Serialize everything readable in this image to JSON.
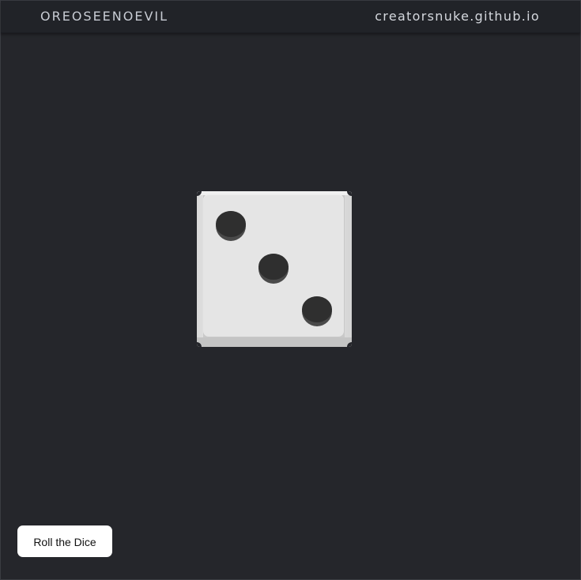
{
  "header": {
    "brand": "OREOSEENOEVIL",
    "site": "creatorsnuke.github.io"
  },
  "die": {
    "value": 3,
    "face_color": "#e5e5e5",
    "pip_color": "#2f2f2f",
    "pip_icon": "die-pip-icon"
  },
  "controls": {
    "roll_label": "Roll the Dice"
  },
  "colors": {
    "background": "#25262b",
    "header": "#212328",
    "header_text": "#c8ccd4",
    "button_bg": "#ffffff",
    "button_text": "#111111"
  }
}
